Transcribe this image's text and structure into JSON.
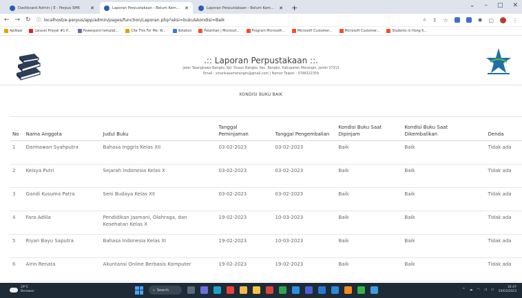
{
  "browser": {
    "tabs": [
      {
        "label": "Dashboard Admin | E - Perpus SMK",
        "active": false
      },
      {
        "label": "Laporan Perpustakaan - Belum Kembali",
        "active": true
      },
      {
        "label": "Laporan Perpustakaan - Belum Kembali",
        "active": false
      }
    ],
    "new_tab_glyph": "+",
    "url": "localhost/e-perpus/app/admin/pages/function/Laporan.php?aksi=buku&kondisi=Baik",
    "bookmarks": [
      "Aplikasi",
      "Laravel Proyek #1 P...",
      "Powerpoint templat...",
      "Cite This For Me: W...",
      "Ibitation",
      "Pelatihan | Microsof...",
      "Program Microsoft...",
      "Microsoft Customer...",
      "Microsoft Customer...",
      "Students in Hong K..."
    ]
  },
  "report": {
    "title": ".:: Laporan Perpustakaan ::.",
    "address": "Jalan Talangkawo Bangko, Kel. Dusun Bangko, Kec. Bangko, Kabupaten Merangin, Jambi 37313",
    "contact": "Email : smankasamerangin@gmail.com | Nomor Telpon : 0746322359",
    "subtitle": "KONDISI BUKU BAIK"
  },
  "table": {
    "headers": [
      "No",
      "Nama Anggota",
      "Judul Buku",
      "Tanggal Peminjaman",
      "Tanggal Pengembalian",
      "Kondisi Buku Saat Dipinjam",
      "Kondisi Buku Saat Dikembalikan",
      "Denda"
    ],
    "rows": [
      [
        "1",
        "Darmawan Syahputra",
        "Bahasa Inggris Kelas XII",
        "03-02-2023",
        "03-02-2023",
        "Baik",
        "Baik",
        "Tidak ada"
      ],
      [
        "2",
        "Keisya Putri",
        "Sejarah Indonesia Kelas X",
        "03-02-2023",
        "03-02-2023",
        "Baik",
        "Baik",
        "Tidak ada"
      ],
      [
        "3",
        "Gandi Kusuma Patra",
        "Seni Budaya Kelas XII",
        "03-02-2023",
        "03-02-2023",
        "Baik",
        "Baik",
        "Tidak ada"
      ],
      [
        "4",
        "Fara Adilla",
        "Pendidikan Jasmani, Olahraga, dan Kesehatan Kelas X",
        "19-02-2023",
        "10-03-2023",
        "Baik",
        "Baik",
        "Tidak ada"
      ],
      [
        "5",
        "Riyan Bayu Saputra",
        "Bahasa Indonesia Kelas XI",
        "19-02-2023",
        "10-03-2023",
        "Baik",
        "Baik",
        "Tidak ada"
      ],
      [
        "6",
        "Airin Renata",
        "Akuntansi Online Berbasis Komputer",
        "19-02-2023",
        "19-02-2023",
        "Baik",
        "Baik",
        "Tidak ada"
      ]
    ]
  },
  "taskbar": {
    "weather_temp": "29°C",
    "weather_desc": "Berawan",
    "search_label": "Search",
    "time": "16:47",
    "date": "10/03/2023"
  },
  "colors": {
    "taskbar_bg": "#1e2a36",
    "tab_strip_bg": "#dfe3eb",
    "logo_book": "#2d3e56",
    "logo_star": "#1f6ea8"
  }
}
